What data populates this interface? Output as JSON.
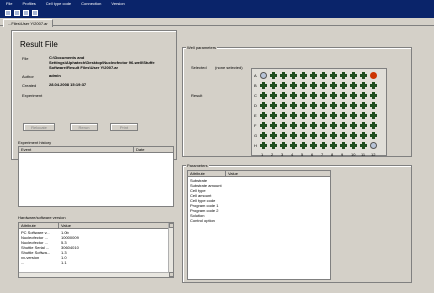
{
  "menu": [
    "File",
    "Profiles",
    "Cell type code",
    "Connection",
    "Version"
  ],
  "tab": {
    "label": "...Files\\User Y\\2007.ar"
  },
  "result_file": {
    "title": "Result File",
    "file_label": "File",
    "file_value_lines": [
      "C:\\Documents and",
      "Settings\\Alphatech\\Desktop\\Nucleofector 96-well\\Stuffe",
      "Software\\Result Files\\User Y\\2007.ar"
    ],
    "author_label": "Author",
    "author_value": "admin",
    "created_label": "Created",
    "created_value": "28.04.2008 15:19:37",
    "experiment_label": "Experiment",
    "buttons": [
      "Relocate",
      "Rerun",
      "Print"
    ]
  },
  "experiment_history": {
    "title": "Experiment history",
    "columns": [
      "Event",
      "Date"
    ],
    "rows": []
  },
  "hardware": {
    "title": "Hardware/software version",
    "columns": [
      "Attribute",
      "Value"
    ],
    "rows": [
      [
        "PC Software v...",
        "1.0b"
      ],
      [
        "Nucleofector ...",
        "10000009"
      ],
      [
        "Nucleofector ...",
        "5.3"
      ],
      [
        "Shuttle Serial ...",
        "30604010"
      ],
      [
        "Shuttle Softwa...",
        "1.3"
      ],
      [
        "xx-version",
        "1.0"
      ],
      [
        "...",
        "1.1"
      ]
    ]
  },
  "well_parameters": {
    "title": "Well parameters",
    "selected_label": "Selected",
    "selected_value": "(none selected)",
    "result_label": "Result",
    "rows": [
      "A",
      "B",
      "C",
      "D",
      "E",
      "F",
      "G",
      "H"
    ],
    "cols": [
      "1",
      "2",
      "3",
      "4",
      "5",
      "6",
      "7",
      "8",
      "9",
      "10",
      "11",
      "12"
    ],
    "row_patterns": [
      [
        "circ",
        "plus",
        "plus",
        "plus",
        "plus",
        "plus",
        "plus",
        "plus",
        "plus",
        "plus",
        "plus",
        "red"
      ],
      [
        "plus",
        "plus",
        "plus",
        "plus",
        "plus",
        "plus",
        "plus",
        "plus",
        "plus",
        "plus",
        "plus",
        "plus"
      ],
      [
        "plus",
        "plus",
        "plus",
        "plus",
        "plus",
        "plus",
        "plus",
        "plus",
        "plus",
        "plus",
        "plus",
        "plus"
      ],
      [
        "plus",
        "plus",
        "plus",
        "plus",
        "plus",
        "plus",
        "plus",
        "plus",
        "plus",
        "plus",
        "plus",
        "plus"
      ],
      [
        "plus",
        "plus",
        "plus",
        "plus",
        "plus",
        "plus",
        "plus",
        "plus",
        "plus",
        "plus",
        "plus",
        "plus"
      ],
      [
        "plus",
        "plus",
        "plus",
        "plus",
        "plus",
        "plus",
        "plus",
        "plus",
        "plus",
        "plus",
        "plus",
        "plus"
      ],
      [
        "plus",
        "plus",
        "plus",
        "plus",
        "plus",
        "plus",
        "plus",
        "plus",
        "plus",
        "plus",
        "plus",
        "plus"
      ],
      [
        "plus",
        "plus",
        "plus",
        "plus",
        "plus",
        "plus",
        "plus",
        "plus",
        "plus",
        "plus",
        "plus",
        "circ"
      ]
    ]
  },
  "parameters": {
    "title": "Parameters",
    "columns": [
      "Attribute",
      "Value"
    ],
    "rows": [
      "Substrate",
      "Substrate amount",
      "Cell type",
      "Cell amount",
      "Cell type code",
      "Program code 1",
      "Program code 2",
      "Solution",
      "Control option"
    ]
  }
}
